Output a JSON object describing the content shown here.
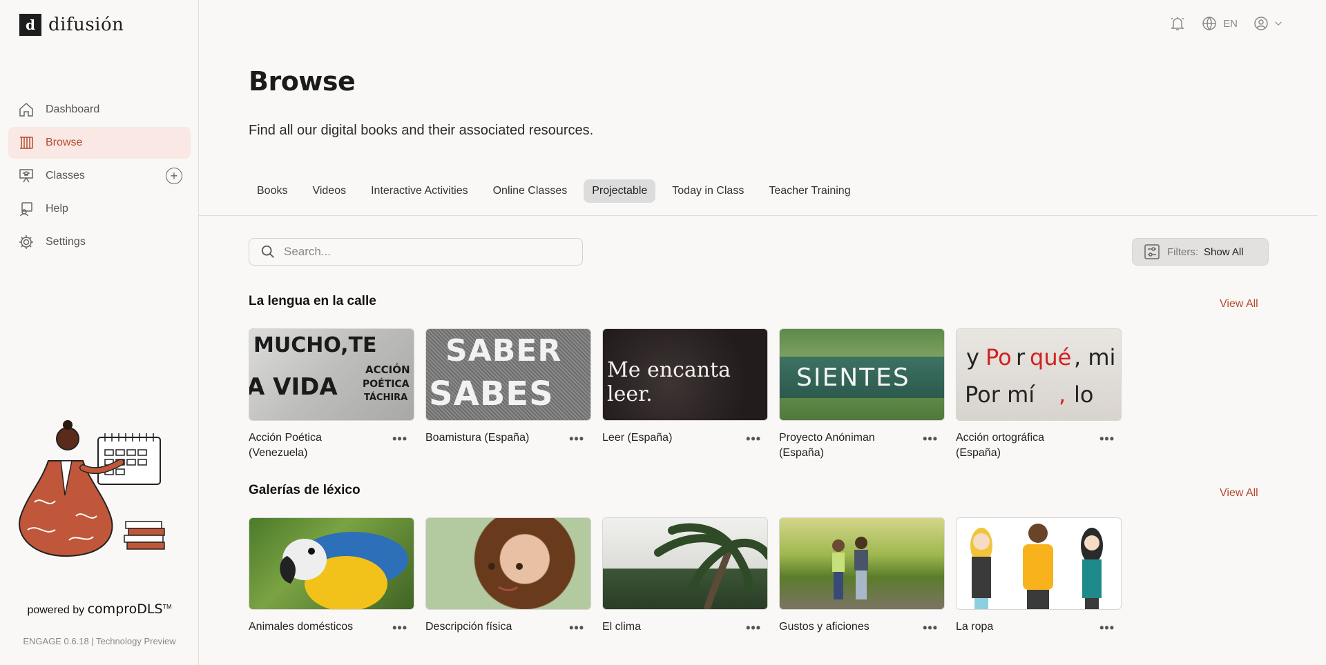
{
  "brand": {
    "logo_letter": "d",
    "name": "difusión"
  },
  "sidebar": {
    "items": [
      {
        "label": "Dashboard",
        "icon": "home-icon",
        "active": false
      },
      {
        "label": "Browse",
        "icon": "library-icon",
        "active": true
      },
      {
        "label": "Classes",
        "icon": "classroom-icon",
        "active": false
      },
      {
        "label": "Help",
        "icon": "help-icon",
        "active": false
      },
      {
        "label": "Settings",
        "icon": "gear-icon",
        "active": false
      }
    ],
    "add_class_symbol": "+",
    "powered_by": "powered by",
    "powered_brand": "comproDLS",
    "trademark": "TM",
    "version": "ENGAGE 0.6.18 | Technology Preview"
  },
  "topbar": {
    "language": "EN"
  },
  "page": {
    "title": "Browse",
    "subtitle": "Find all our digital books and their associated resources."
  },
  "tabs": [
    {
      "label": "Books",
      "active": false
    },
    {
      "label": "Videos",
      "active": false
    },
    {
      "label": "Interactive Activities",
      "active": false
    },
    {
      "label": "Online Classes",
      "active": false
    },
    {
      "label": "Projectable",
      "active": true
    },
    {
      "label": "Today in Class",
      "active": false
    },
    {
      "label": "Teacher Training",
      "active": false
    }
  ],
  "search": {
    "placeholder": "Search..."
  },
  "filters": {
    "label": "Filters:",
    "value": "Show All"
  },
  "sections": [
    {
      "title": "La lengua en la calle",
      "view_all": "View All",
      "cards": [
        {
          "title": "Acción Poética (Venezuela)",
          "thumb_text": [
            "MUCHO,TE",
            "A VIDA",
            "ACCIÓN",
            "POÉTICA",
            "TÁCHIRA"
          ]
        },
        {
          "title": "Boamistura (España)",
          "thumb_text": [
            "SABER",
            "SABES"
          ]
        },
        {
          "title": "Leer (España)",
          "thumb_text": [
            "Me encanta leer."
          ]
        },
        {
          "title": "Proyecto Anóniman (España)",
          "thumb_text": [
            "SIENTES"
          ]
        },
        {
          "title": "Acción ortográfica (España)",
          "thumb_text": [
            "y",
            "Po",
            "r",
            "qué",
            ", mi",
            "Por mí",
            ",",
            "lo"
          ]
        }
      ]
    },
    {
      "title": "Galerías de léxico",
      "view_all": "View All",
      "cards": [
        {
          "title": "Animales domésticos"
        },
        {
          "title": "Descripción física"
        },
        {
          "title": "El clima"
        },
        {
          "title": "Gustos y aficiones"
        },
        {
          "title": "La ropa"
        }
      ]
    }
  ],
  "more_symbol": "•••",
  "colors": {
    "accent": "#b44a2c",
    "active_bg": "#f9e8e3",
    "bg": "#f9f8f6"
  }
}
